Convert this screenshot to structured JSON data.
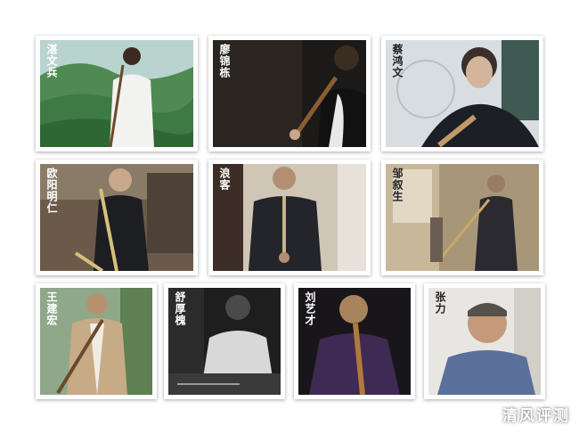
{
  "cards": [
    {
      "name": "湛文兵"
    },
    {
      "name": "廖锦栋"
    },
    {
      "name": "蔡鸿文"
    },
    {
      "name": "欧阳明仁"
    },
    {
      "name": "浪客"
    },
    {
      "name": "邹叙生"
    },
    {
      "name": "王建宏"
    },
    {
      "name": "舒厚槐"
    },
    {
      "name": "刘艺才"
    },
    {
      "name": "张力"
    }
  ],
  "watermark": "清风评测",
  "colors": {
    "background": "#ffffff",
    "card_border": "#ffffff",
    "name_on_dark": "#ffffff",
    "name_on_light": "#222222"
  }
}
